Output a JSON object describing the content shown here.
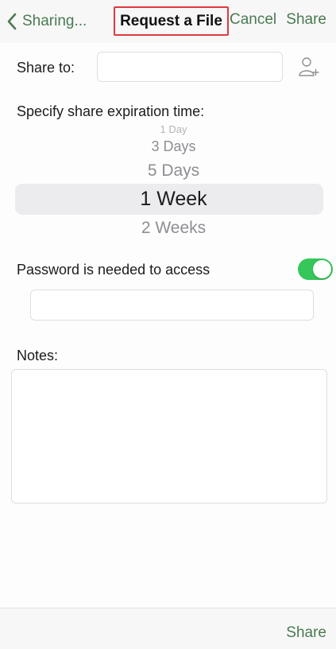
{
  "navbar": {
    "back_label": "Sharing...",
    "title": "Request a File",
    "cancel_label": "Cancel",
    "share_label": "Share"
  },
  "share_to": {
    "label": "Share to:",
    "value": ""
  },
  "expiration": {
    "label": "Specify share expiration time:",
    "options": [
      "1 Day",
      "3 Days",
      "5 Days",
      "1 Week",
      "2 Weeks"
    ],
    "selected": "1 Week"
  },
  "password": {
    "label": "Password is needed to access",
    "enabled": true,
    "value": ""
  },
  "notes": {
    "label": "Notes:",
    "value": ""
  },
  "bottom_bar": {
    "share_label": "Share"
  },
  "colors": {
    "accent": "#4a7a52",
    "toggle_on": "#35c759",
    "highlight_border": "#e0393e"
  }
}
